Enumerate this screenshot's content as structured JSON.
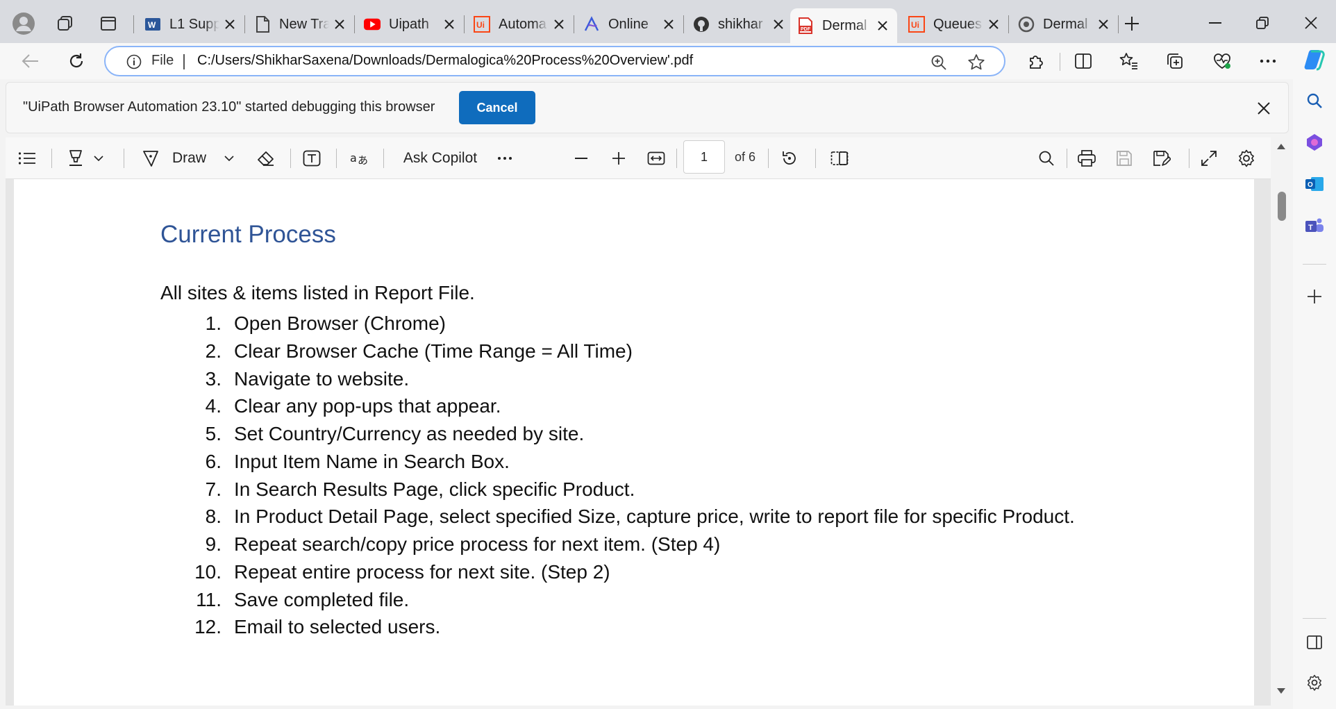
{
  "tabs": [
    {
      "title": "L1 Supp",
      "icon": "word-icon",
      "icon_color": "#2b579a"
    },
    {
      "title": "New Tra",
      "icon": "document-icon",
      "icon_color": "#555555"
    },
    {
      "title": "Uipath",
      "icon": "youtube-icon",
      "icon_color": "#ff0000"
    },
    {
      "title": "Automa",
      "icon": "uipath-icon",
      "icon_color": "#fa4616"
    },
    {
      "title": "Online",
      "icon": "pen-logo-icon",
      "icon_color": "#3b5bdb"
    },
    {
      "title": "shikhar",
      "icon": "github-icon",
      "icon_color": "#333333"
    },
    {
      "title": "Dermal",
      "icon": "pdf-icon",
      "icon_color": "#d9342b",
      "active": true
    },
    {
      "title": "Queues",
      "icon": "uipath-icon",
      "icon_color": "#fa4616"
    },
    {
      "title": "Dermal",
      "icon": "circle-logo-icon",
      "icon_color": "#555555"
    }
  ],
  "address": {
    "scheme_label": "File",
    "url": "C:/Users/ShikharSaxena/Downloads/Dermalogica%20Process%20Overview'.pdf"
  },
  "infobar": {
    "message": "\"UiPath Browser Automation 23.10\" started debugging this browser",
    "cancel_label": "Cancel"
  },
  "pdf_toolbar": {
    "draw_label": "Draw",
    "copilot_label": "Ask Copilot",
    "page_current": "1",
    "page_total_label": "of 6"
  },
  "document": {
    "heading": "Current Process",
    "intro": "All sites & items listed in Report File.",
    "steps": [
      {
        "num": "1.",
        "text": "Open Browser (Chrome)"
      },
      {
        "num": "2.",
        "text": "Clear Browser Cache (Time Range = All Time)"
      },
      {
        "num": "3.",
        "text": "Navigate to website."
      },
      {
        "num": "4.",
        "text": "Clear any pop-ups that appear."
      },
      {
        "num": "5.",
        "text": "Set Country/Currency as needed by site."
      },
      {
        "num": "6.",
        "text": "Input Item Name in Search Box."
      },
      {
        "num": "7.",
        "text": "In Search Results Page, click specific Product."
      },
      {
        "num": "8.",
        "text": "In Product Detail Page, select specified Size, capture price, write to report file for specific Product."
      },
      {
        "num": "9.",
        "text": "Repeat search/copy price process for next item. (Step 4)"
      },
      {
        "num": "10.",
        "text": "Repeat entire process for next site. (Step 2)"
      },
      {
        "num": "11.",
        "text": "Save completed file."
      },
      {
        "num": "12.",
        "text": "Email to selected users."
      }
    ]
  },
  "colors": {
    "accent": "#0f6cbd",
    "heading": "#2f5496",
    "omnibox_border": "#8ab4f8"
  }
}
